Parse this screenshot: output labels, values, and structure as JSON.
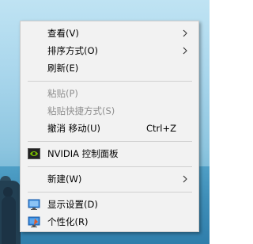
{
  "context_menu": {
    "items": [
      {
        "label": "查看(V)",
        "has_submenu": true
      },
      {
        "label": "排序方式(O)",
        "has_submenu": true
      },
      {
        "label": "刷新(E)"
      },
      {
        "label": "粘贴(P)",
        "disabled": true
      },
      {
        "label": "粘贴快捷方式(S)",
        "disabled": true
      },
      {
        "label": "撤消 移动(U)",
        "shortcut": "Ctrl+Z"
      },
      {
        "label": "NVIDIA 控制面板",
        "icon": "nvidia-icon"
      },
      {
        "label": "新建(W)",
        "has_submenu": true
      },
      {
        "label": "显示设置(D)",
        "icon": "display-settings-icon"
      },
      {
        "label": "个性化(R)",
        "icon": "personalize-icon"
      }
    ]
  },
  "colors": {
    "menu_background": "#f2f2f2",
    "disabled_text": "#8f8f8f",
    "nvidia_green": "#76b900"
  }
}
